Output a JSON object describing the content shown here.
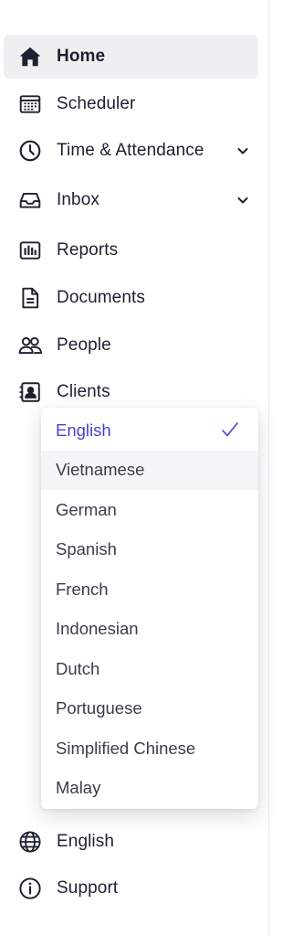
{
  "nav": {
    "items": [
      {
        "label": "Home",
        "icon": "home-icon",
        "active": true
      },
      {
        "label": "Scheduler",
        "icon": "calendar-icon"
      },
      {
        "label": "Time & Attendance",
        "icon": "clock-icon",
        "expandable": true
      },
      {
        "label": "Inbox",
        "icon": "inbox-icon",
        "expandable": true
      },
      {
        "label": "Reports",
        "icon": "bar-chart-icon"
      },
      {
        "label": "Documents",
        "icon": "document-icon"
      },
      {
        "label": "People",
        "icon": "people-icon"
      },
      {
        "label": "Clients",
        "icon": "contact-card-icon"
      }
    ],
    "language_label": "English",
    "support_label": "Support"
  },
  "language_dropdown": {
    "selected": "English",
    "hovered": "Vietnamese",
    "options": [
      "English",
      "Vietnamese",
      "German",
      "Spanish",
      "French",
      "Indonesian",
      "Dutch",
      "Portuguese",
      "Simplified Chinese",
      "Malay"
    ]
  },
  "colors": {
    "accent": "#4a3fcf",
    "active_bg": "#efeff1",
    "text": "#1d2130",
    "border": "#ececf0"
  }
}
